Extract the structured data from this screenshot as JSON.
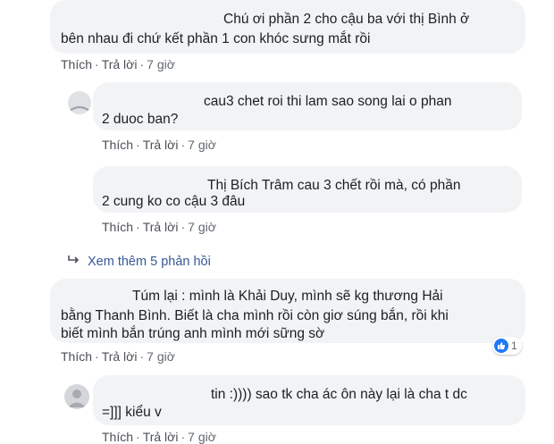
{
  "comments": [
    {
      "lines": [
        "Chú ơi phần 2 cho cậu ba với thị Bình ở",
        "bên nhau đi chứ kết phần 1 con khóc sưng mắt rồi"
      ],
      "like": "Thích",
      "reply": "Trả lời",
      "time": "7 giờ"
    },
    {
      "lines": [
        "cau3 chet roi thi lam sao song lai o phan",
        "2 duoc ban?"
      ],
      "like": "Thích",
      "reply": "Trả lời",
      "time": "7 giờ"
    },
    {
      "lines": [
        "Thị Bích Trâm cau 3 chết rồi mà, có phần",
        "2 cung ko co cậu 3 đâu"
      ],
      "like": "Thích",
      "reply": "Trả lời",
      "time": "7 giờ"
    },
    {
      "lines": [
        "Túm lại : mình là Khải Duy, mình sẽ kg thương Hải",
        "bằng Thanh Bình. Biết là cha mình rồi còn giơ súng bắn, rồi khi",
        "biết mình bắn trúng anh mình mới sững sờ"
      ],
      "like": "Thích",
      "reply": "Trả lời",
      "time": "7 giờ",
      "reaction_count": "1"
    },
    {
      "lines": [
        "tin :)))) sao tk cha ác ôn này lại là cha t dc",
        "=]]] kiểu v"
      ],
      "like": "Thích",
      "reply": "Trả lời",
      "time": "7 giờ"
    }
  ],
  "view_more": "Xem thêm 5 phản hồi",
  "colors": {
    "bubble": "#f2f3f5",
    "link": "#385898",
    "meta": "#606770",
    "like_blue": "#2078f4"
  }
}
